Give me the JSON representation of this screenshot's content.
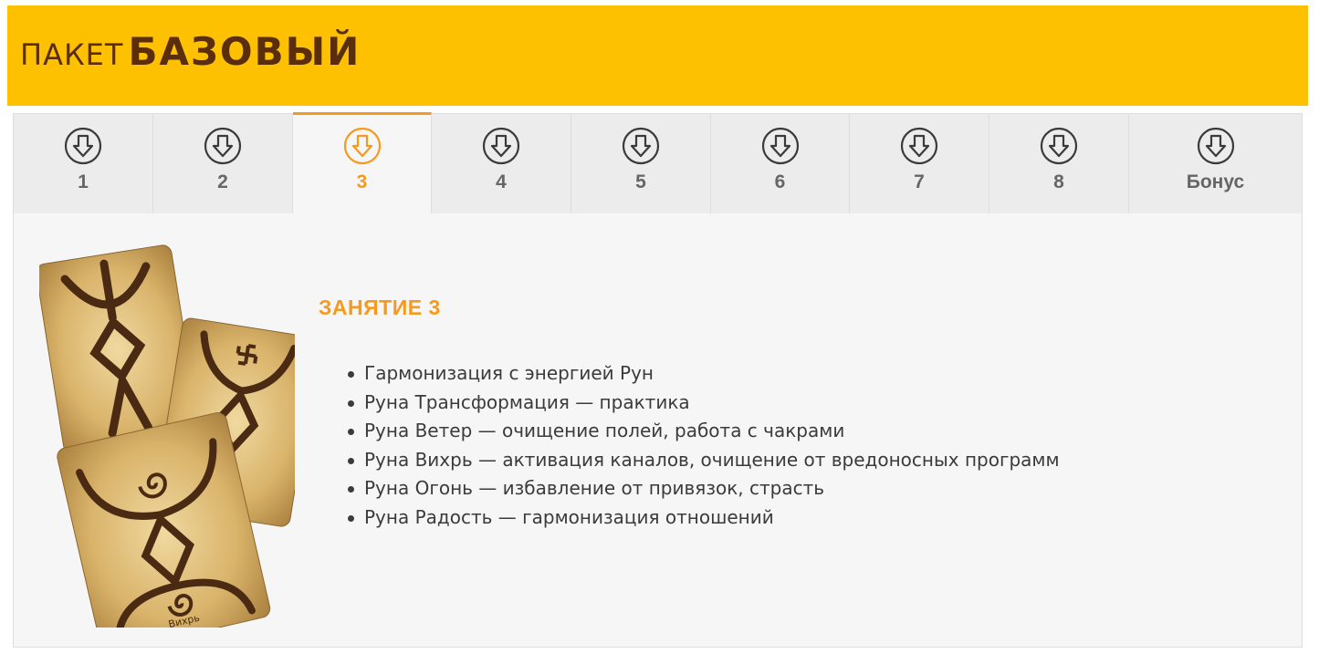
{
  "header": {
    "title_prefix": "ПАКЕТ",
    "title_main": "БАЗОВЫЙ",
    "background": "#fec102",
    "text_color": "#5a2d0c"
  },
  "tabs": [
    {
      "label": "1",
      "icon": "arrow-down-circle-icon",
      "active": false
    },
    {
      "label": "2",
      "icon": "arrow-down-circle-icon",
      "active": false
    },
    {
      "label": "3",
      "icon": "arrow-down-circle-icon",
      "active": true
    },
    {
      "label": "4",
      "icon": "arrow-down-circle-icon",
      "active": false
    },
    {
      "label": "5",
      "icon": "arrow-down-circle-icon",
      "active": false
    },
    {
      "label": "6",
      "icon": "arrow-down-circle-icon",
      "active": false
    },
    {
      "label": "7",
      "icon": "arrow-down-circle-icon",
      "active": false
    },
    {
      "label": "8",
      "icon": "arrow-down-circle-icon",
      "active": false
    },
    {
      "label": "Бонус",
      "icon": "arrow-down-circle-icon",
      "active": false
    }
  ],
  "accent_color": "#f59a1e",
  "lesson": {
    "title": "ЗАНЯТИЕ 3",
    "items": [
      "Гармонизация с энергией Рун",
      "Руна Трансформация — практика",
      "Руна Ветер — очищение полей, работа с чакрами",
      "Руна Вихрь — активация каналов, очищение от вредоносных программ",
      "Руна Огонь — избавление от привязок, страсть",
      "Руна Радость — гармонизация отношений"
    ]
  },
  "cards_image": {
    "card_label": "Вихрь"
  }
}
